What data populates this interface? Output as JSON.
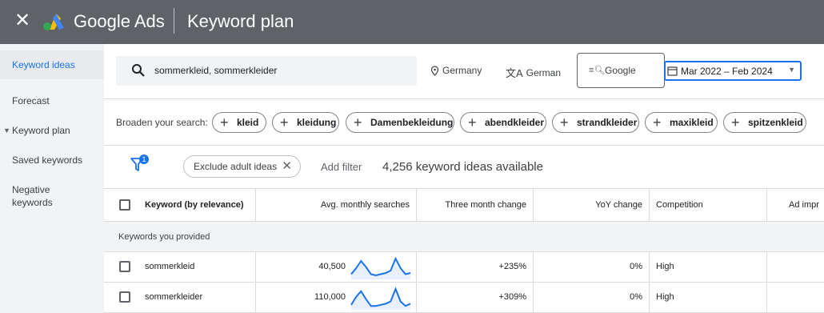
{
  "header": {
    "close_icon": "close-icon",
    "brand": "Google Ads",
    "title": "Keyword plan"
  },
  "sidebar": {
    "items": [
      {
        "label": "Keyword ideas",
        "active": true
      },
      {
        "label": "Forecast"
      },
      {
        "label": "Keyword plan",
        "expandable": true
      },
      {
        "label": "Saved keywords"
      },
      {
        "label": "Negative keywords"
      }
    ]
  },
  "search": {
    "value": "sommerkleid, sommerkleider",
    "location": "Germany",
    "language": "German",
    "network": "Google",
    "date_range": "Mar 2022 – Feb 2024"
  },
  "broaden": {
    "label": "Broaden your search:",
    "chips": [
      "kleid",
      "kleidung",
      "Damenbekleidung",
      "abendkleider",
      "strandkleider",
      "maxikleid",
      "spitzenkleid"
    ]
  },
  "filters": {
    "badge": "1",
    "adult_chip": "Exclude adult ideas",
    "add_filter": "Add filter",
    "ideas_count": "4,256 keyword ideas available"
  },
  "table": {
    "columns": [
      "Keyword (by relevance)",
      "Avg. monthly searches",
      "Three month change",
      "YoY change",
      "Competition",
      "Ad impr"
    ],
    "group_label": "Keywords you provided",
    "rows": [
      {
        "keyword": "sommerkleid",
        "avg": "40,500",
        "three_month": "+235%",
        "yoy": "0%",
        "competition": "High",
        "trend": [
          3,
          8,
          14,
          9,
          3,
          2,
          3,
          4,
          6,
          16,
          8,
          3,
          4
        ]
      },
      {
        "keyword": "sommerkleider",
        "avg": "110,000",
        "three_month": "+309%",
        "yoy": "0%",
        "competition": "High",
        "trend": [
          3,
          10,
          15,
          8,
          2,
          2,
          3,
          4,
          6,
          17,
          6,
          2,
          4
        ]
      }
    ]
  },
  "colors": {
    "header_bg": "#5f6368",
    "accent": "#1a73e8",
    "sidebar_bg": "#f1f3f4"
  }
}
